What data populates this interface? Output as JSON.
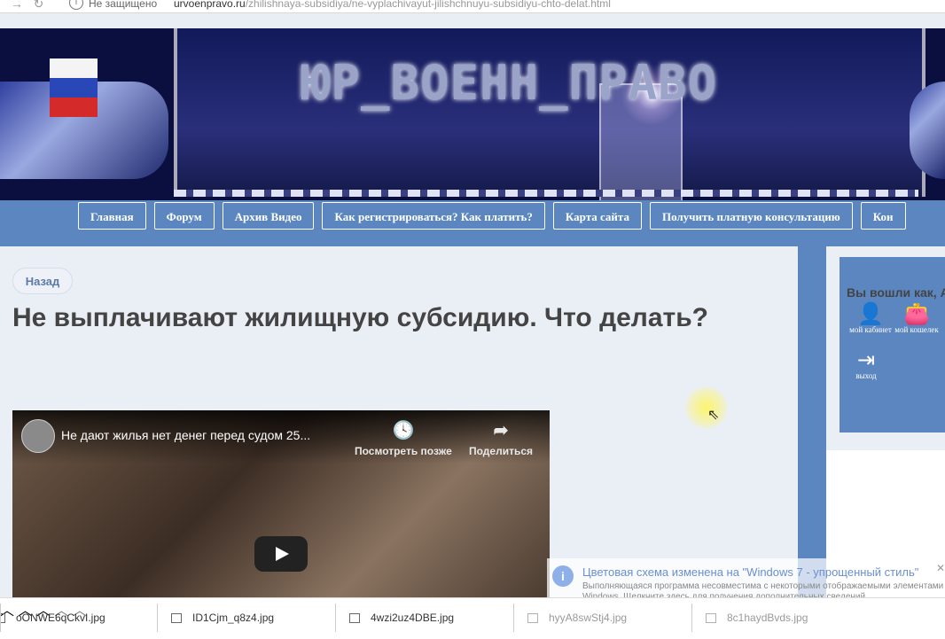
{
  "browser": {
    "security_text": "Не защищено",
    "url_domain": "urvoenpravo.ru",
    "url_path": "/zhilishnaya-subsidiya/ne-vyplachivayut-jilishchnuyu-subsidiyu-chto-delat.html"
  },
  "banner": {
    "logo_text": "ЮР_ВОЕНН_ПРАВО"
  },
  "menu": {
    "items": [
      {
        "label": "Главная"
      },
      {
        "label": "Форум"
      },
      {
        "label": "Архив Видео"
      },
      {
        "label": "Как регистрироваться? Как платить?"
      },
      {
        "label": "Карта сайта"
      },
      {
        "label": "Получить платную консультацию"
      },
      {
        "label": "Кон"
      }
    ]
  },
  "article": {
    "back_label": "Назад",
    "title": "Не выплачивают жилищную субсидию. Что делать?",
    "video": {
      "title": "Не дают жилья нет денег перед судом 25...",
      "watch_later": "Посмотреть позже",
      "share": "Поделиться"
    }
  },
  "user_panel": {
    "greeting": "Вы вошли как, А",
    "cabinet_label": "мой кабинет",
    "wallet_label": "мой кошелек",
    "logout_label": "выход"
  },
  "notification": {
    "title": "Цветовая схема изменена на \"Windows 7 - упрощенный стиль\"",
    "body": "Выполняющаяся программа несовместима с некоторыми отображаемыми элементами Windows. Щелкните здесь для получения дополнительных сведений."
  },
  "downloads": [
    {
      "name": "oONWE6qCkvI.jpg"
    },
    {
      "name": "ID1Cjm_q8z4.jpg"
    },
    {
      "name": "4wzi2uz4DBE.jpg"
    },
    {
      "name": "hyyA8swStj4.jpg"
    },
    {
      "name": "8c1haydBvds.jpg"
    }
  ],
  "colors": {
    "menu_blue": "#5b86c0",
    "page_bg": "#eaeff6",
    "title_text": "#444444"
  }
}
